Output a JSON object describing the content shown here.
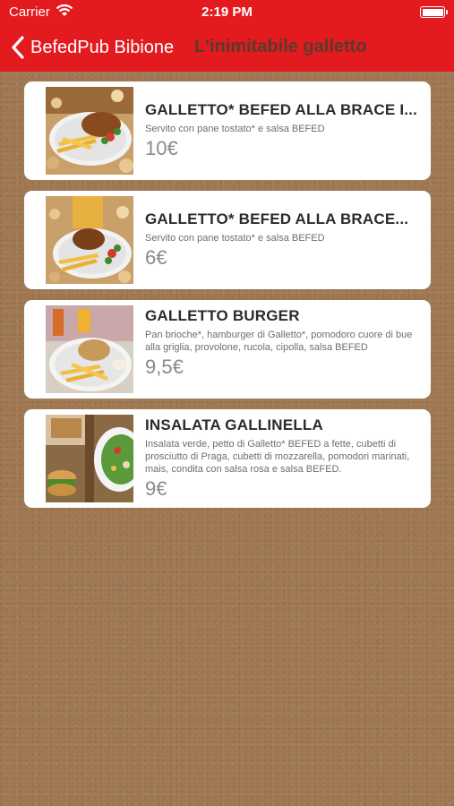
{
  "status_bar": {
    "carrier": "Carrier",
    "time": "2:19 PM"
  },
  "nav": {
    "back_label": "BefedPub Bibione",
    "title": "L'inimitabile galletto"
  },
  "items": [
    {
      "title": "GALLETTO* BEFED ALLA BRACE I...",
      "description": "Servito con pane tostato* e salsa BEFED",
      "price": "10€"
    },
    {
      "title": "GALLETTO* BEFED ALLA BRACE...",
      "description": "Servito con pane tostato* e salsa BEFED",
      "price": "6€"
    },
    {
      "title": "GALLETTO BURGER",
      "description": "Pan brioche*, hamburger di Galletto*, pomodoro cuore di bue alla griglia, provolone, rucola, cipolla, salsa BEFED",
      "price": "9,5€"
    },
    {
      "title": "INSALATA GALLINELLA",
      "description": "Insalata verde, petto di Galletto* BEFED a fette, cubetti di prosciutto di Praga, cubetti di mozzarella, pomodori marinati, mais, condita con salsa rosa e salsa BEFED.",
      "price": "9€"
    }
  ],
  "colors": {
    "header": "#e31b1f",
    "title_text": "#5a3a2c",
    "background": "#a27a55"
  }
}
